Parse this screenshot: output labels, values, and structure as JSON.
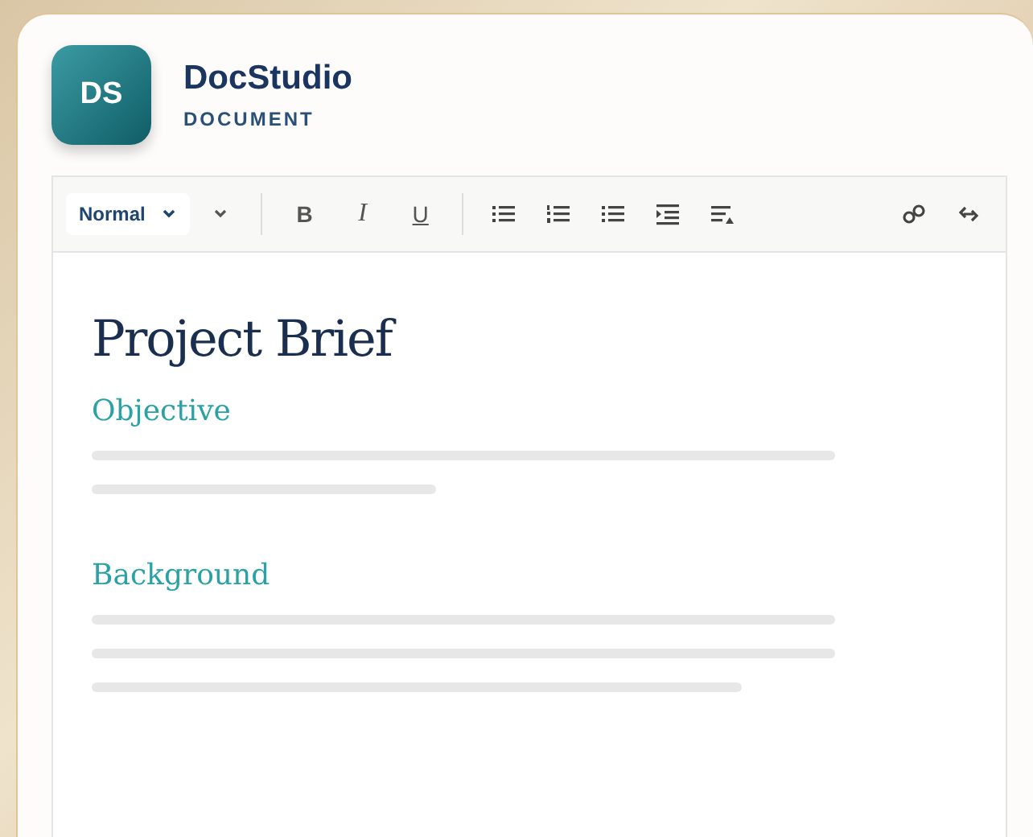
{
  "app": {
    "logo": "DS",
    "title": "DocStudio",
    "subtitle": "DOCUMENT"
  },
  "toolbar": {
    "style_select": "Normal",
    "format_buttons": [
      "B",
      "I",
      "U"
    ]
  },
  "document": {
    "title": "Project Brief",
    "sections": [
      {
        "heading": "Objective"
      },
      {
        "heading": "Background"
      }
    ]
  }
}
